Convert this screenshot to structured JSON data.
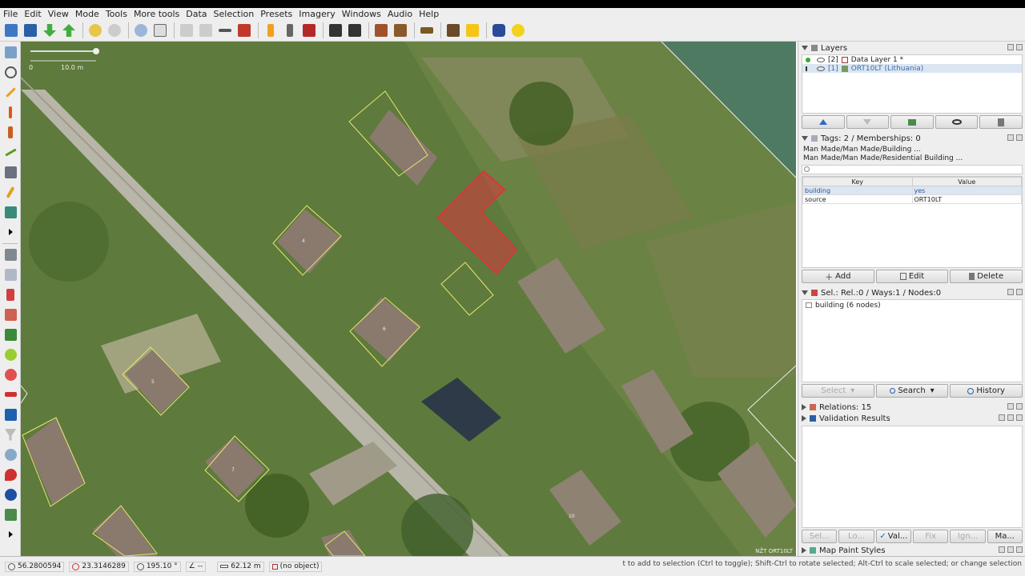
{
  "menu": [
    {
      "label": "File",
      "u": "F"
    },
    {
      "label": "Edit",
      "u": "E"
    },
    {
      "label": "View",
      "u": "V"
    },
    {
      "label": "Mode",
      "u": "M"
    },
    {
      "label": "Tools",
      "u": "T"
    },
    {
      "label": "More tools",
      "u": "o"
    },
    {
      "label": "Data",
      "u": "D"
    },
    {
      "label": "Selection",
      "u": "S"
    },
    {
      "label": "Presets",
      "u": "P"
    },
    {
      "label": "Imagery",
      "u": "I"
    },
    {
      "label": "Windows",
      "u": "W"
    },
    {
      "label": "Audio",
      "u": "A"
    },
    {
      "label": "Help",
      "u": "H"
    }
  ],
  "map": {
    "scale_zero": "0",
    "scale_label": "10.0 m",
    "attribution": "NŽT ORT10LT",
    "labels": [
      "4",
      "6",
      "5",
      "7",
      "10"
    ]
  },
  "layers": {
    "title": "Layers",
    "items": [
      {
        "index": "[2]",
        "name": "Data Layer 1 *"
      },
      {
        "index": "[1]",
        "name": "ORT10LT (Lithuania)"
      }
    ]
  },
  "tags": {
    "title": "Tags: 2 / Memberships: 0",
    "presets": [
      "Man Made/Man Made/Building ...",
      "Man Made/Man Made/Residential Building ..."
    ],
    "key_header": "Key",
    "value_header": "Value",
    "rows": [
      {
        "key": "building",
        "value": "yes"
      },
      {
        "key": "source",
        "value": "ORT10LT"
      }
    ],
    "add": "Add",
    "edit": "Edit",
    "delete": "Delete"
  },
  "selection": {
    "title": "Sel.: Rel.:0 / Ways:1 / Nodes:0",
    "items": [
      "building (6 nodes)"
    ],
    "select": "Select",
    "search": "Search",
    "history": "History"
  },
  "relations": {
    "title": "Relations: 15"
  },
  "validation": {
    "title": "Validation Results",
    "tabs": [
      "Sel...",
      "Lo...",
      "Val...",
      "Fix",
      "Ign...",
      "Ma..."
    ]
  },
  "map_paint": {
    "title": "Map Paint Styles"
  },
  "status": {
    "lat": "56.2800594",
    "lon": "23.3146289",
    "heading": "195.10 °",
    "angle": "--",
    "distance": "62.12 m",
    "object": "(no object)",
    "help": "t to add to selection (Ctrl to toggle); Shift-Ctrl to rotate selected; Alt-Ctrl to scale selected; or change selection"
  },
  "colors": {
    "selected_building": "#d9363e",
    "building_outline": "#e6e66a",
    "ui_bg": "#eeeeee"
  }
}
